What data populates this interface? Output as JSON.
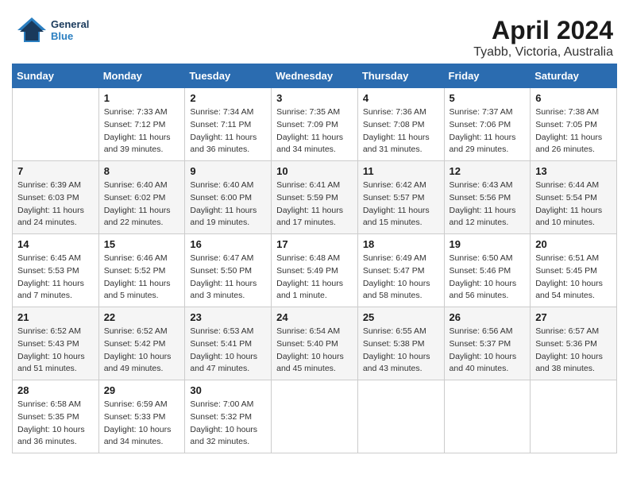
{
  "header": {
    "logo_general": "General",
    "logo_blue": "Blue",
    "title": "April 2024",
    "subtitle": "Tyabb, Victoria, Australia"
  },
  "columns": [
    "Sunday",
    "Monday",
    "Tuesday",
    "Wednesday",
    "Thursday",
    "Friday",
    "Saturday"
  ],
  "weeks": [
    {
      "days": [
        {
          "num": "",
          "detail": ""
        },
        {
          "num": "1",
          "detail": "Sunrise: 7:33 AM\nSunset: 7:12 PM\nDaylight: 11 hours\nand 39 minutes."
        },
        {
          "num": "2",
          "detail": "Sunrise: 7:34 AM\nSunset: 7:11 PM\nDaylight: 11 hours\nand 36 minutes."
        },
        {
          "num": "3",
          "detail": "Sunrise: 7:35 AM\nSunset: 7:09 PM\nDaylight: 11 hours\nand 34 minutes."
        },
        {
          "num": "4",
          "detail": "Sunrise: 7:36 AM\nSunset: 7:08 PM\nDaylight: 11 hours\nand 31 minutes."
        },
        {
          "num": "5",
          "detail": "Sunrise: 7:37 AM\nSunset: 7:06 PM\nDaylight: 11 hours\nand 29 minutes."
        },
        {
          "num": "6",
          "detail": "Sunrise: 7:38 AM\nSunset: 7:05 PM\nDaylight: 11 hours\nand 26 minutes."
        }
      ]
    },
    {
      "days": [
        {
          "num": "7",
          "detail": "Sunrise: 6:39 AM\nSunset: 6:03 PM\nDaylight: 11 hours\nand 24 minutes."
        },
        {
          "num": "8",
          "detail": "Sunrise: 6:40 AM\nSunset: 6:02 PM\nDaylight: 11 hours\nand 22 minutes."
        },
        {
          "num": "9",
          "detail": "Sunrise: 6:40 AM\nSunset: 6:00 PM\nDaylight: 11 hours\nand 19 minutes."
        },
        {
          "num": "10",
          "detail": "Sunrise: 6:41 AM\nSunset: 5:59 PM\nDaylight: 11 hours\nand 17 minutes."
        },
        {
          "num": "11",
          "detail": "Sunrise: 6:42 AM\nSunset: 5:57 PM\nDaylight: 11 hours\nand 15 minutes."
        },
        {
          "num": "12",
          "detail": "Sunrise: 6:43 AM\nSunset: 5:56 PM\nDaylight: 11 hours\nand 12 minutes."
        },
        {
          "num": "13",
          "detail": "Sunrise: 6:44 AM\nSunset: 5:54 PM\nDaylight: 11 hours\nand 10 minutes."
        }
      ]
    },
    {
      "days": [
        {
          "num": "14",
          "detail": "Sunrise: 6:45 AM\nSunset: 5:53 PM\nDaylight: 11 hours\nand 7 minutes."
        },
        {
          "num": "15",
          "detail": "Sunrise: 6:46 AM\nSunset: 5:52 PM\nDaylight: 11 hours\nand 5 minutes."
        },
        {
          "num": "16",
          "detail": "Sunrise: 6:47 AM\nSunset: 5:50 PM\nDaylight: 11 hours\nand 3 minutes."
        },
        {
          "num": "17",
          "detail": "Sunrise: 6:48 AM\nSunset: 5:49 PM\nDaylight: 11 hours\nand 1 minute."
        },
        {
          "num": "18",
          "detail": "Sunrise: 6:49 AM\nSunset: 5:47 PM\nDaylight: 10 hours\nand 58 minutes."
        },
        {
          "num": "19",
          "detail": "Sunrise: 6:50 AM\nSunset: 5:46 PM\nDaylight: 10 hours\nand 56 minutes."
        },
        {
          "num": "20",
          "detail": "Sunrise: 6:51 AM\nSunset: 5:45 PM\nDaylight: 10 hours\nand 54 minutes."
        }
      ]
    },
    {
      "days": [
        {
          "num": "21",
          "detail": "Sunrise: 6:52 AM\nSunset: 5:43 PM\nDaylight: 10 hours\nand 51 minutes."
        },
        {
          "num": "22",
          "detail": "Sunrise: 6:52 AM\nSunset: 5:42 PM\nDaylight: 10 hours\nand 49 minutes."
        },
        {
          "num": "23",
          "detail": "Sunrise: 6:53 AM\nSunset: 5:41 PM\nDaylight: 10 hours\nand 47 minutes."
        },
        {
          "num": "24",
          "detail": "Sunrise: 6:54 AM\nSunset: 5:40 PM\nDaylight: 10 hours\nand 45 minutes."
        },
        {
          "num": "25",
          "detail": "Sunrise: 6:55 AM\nSunset: 5:38 PM\nDaylight: 10 hours\nand 43 minutes."
        },
        {
          "num": "26",
          "detail": "Sunrise: 6:56 AM\nSunset: 5:37 PM\nDaylight: 10 hours\nand 40 minutes."
        },
        {
          "num": "27",
          "detail": "Sunrise: 6:57 AM\nSunset: 5:36 PM\nDaylight: 10 hours\nand 38 minutes."
        }
      ]
    },
    {
      "days": [
        {
          "num": "28",
          "detail": "Sunrise: 6:58 AM\nSunset: 5:35 PM\nDaylight: 10 hours\nand 36 minutes."
        },
        {
          "num": "29",
          "detail": "Sunrise: 6:59 AM\nSunset: 5:33 PM\nDaylight: 10 hours\nand 34 minutes."
        },
        {
          "num": "30",
          "detail": "Sunrise: 7:00 AM\nSunset: 5:32 PM\nDaylight: 10 hours\nand 32 minutes."
        },
        {
          "num": "",
          "detail": ""
        },
        {
          "num": "",
          "detail": ""
        },
        {
          "num": "",
          "detail": ""
        },
        {
          "num": "",
          "detail": ""
        }
      ]
    }
  ]
}
